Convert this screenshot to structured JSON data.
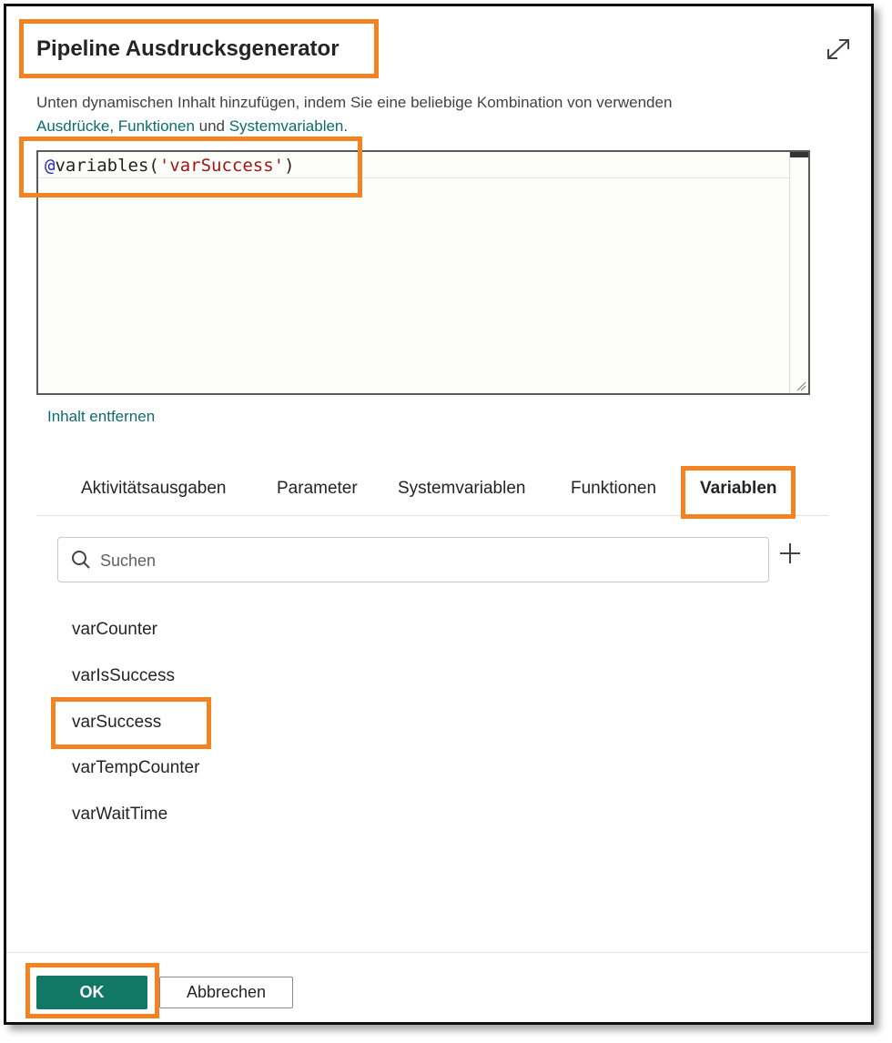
{
  "dialog": {
    "title": "Pipeline Ausdrucksgenerator",
    "description_prefix": "Unten dynamischen Inhalt hinzufügen, indem Sie eine beliebige Kombination von verwenden",
    "link_expressions": "Ausdrücke",
    "separator_comma": ", ",
    "link_functions": "Funktionen",
    "word_and": " und ",
    "link_system_variables": "Systemvariablen",
    "period": "."
  },
  "editor": {
    "code_at": "@",
    "code_fn": "variables(",
    "code_str": "'varSuccess'",
    "code_close": ")"
  },
  "remove_content_label": "Inhalt entfernen",
  "tabs": [
    {
      "label": "Aktivitätsausgaben"
    },
    {
      "label": "Parameter"
    },
    {
      "label": "Systemvariablen"
    },
    {
      "label": "Funktionen"
    },
    {
      "label": "Variablen",
      "active": true
    }
  ],
  "search": {
    "placeholder": "Suchen",
    "value": ""
  },
  "variables": [
    "varCounter",
    "varIsSuccess",
    "varSuccess",
    "varTempCounter",
    "varWaitTime"
  ],
  "footer": {
    "ok_label": "OK",
    "cancel_label": "Abbrechen"
  },
  "colors": {
    "highlight": "#f58220",
    "primary": "#117865",
    "link": "#0f6c6c"
  },
  "icons": {
    "expand": "expand-icon",
    "search": "search-icon",
    "add": "plus-icon"
  }
}
